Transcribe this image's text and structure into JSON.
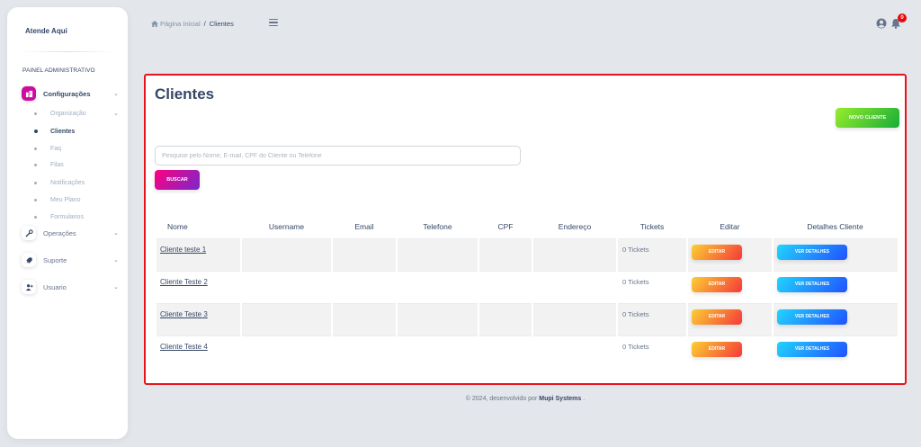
{
  "sidebar": {
    "brand": "Atende Aqui",
    "section_label": "PAINEL ADMINISTRATIVO",
    "nav": [
      {
        "label": "Configurações",
        "icon": "building-icon",
        "active": true
      },
      {
        "label": "Operações",
        "icon": "tools-icon",
        "active": false
      },
      {
        "label": "Suporte",
        "icon": "rocket-icon",
        "active": false
      },
      {
        "label": "Usuario",
        "icon": "user-plus-icon",
        "active": false
      }
    ],
    "sub_items": [
      {
        "label": "Organização",
        "active": false,
        "has_chevron": true
      },
      {
        "label": "Clientes",
        "active": true,
        "has_chevron": false
      },
      {
        "label": "Faq",
        "active": false,
        "has_chevron": false
      },
      {
        "label": "Filas",
        "active": false,
        "has_chevron": false
      },
      {
        "label": "Notificações",
        "active": false,
        "has_chevron": false
      },
      {
        "label": "Meu Plano",
        "active": false,
        "has_chevron": false
      },
      {
        "label": "Formularios",
        "active": false,
        "has_chevron": false
      }
    ]
  },
  "topbar": {
    "breadcrumb_home": "Página Inicial",
    "breadcrumb_sep": "/",
    "breadcrumb_current": "Clientes",
    "notification_count": "0"
  },
  "main": {
    "title": "Clientes",
    "new_button": "NOVO CLIENTE",
    "search_placeholder": "Pesquise pelo Nome, E-mail, CPF do Cliente ou Telefone",
    "search_value": "",
    "search_button": "BUSCAR",
    "table": {
      "headers": [
        "Nome",
        "Username",
        "Email",
        "Telefone",
        "CPF",
        "Endereço",
        "Tickets",
        "Editar",
        "Detalhes Cliente"
      ],
      "rows": [
        {
          "name": "Cliente teste 1",
          "tickets": "0 Tickets",
          "edit": "EDITAR",
          "details": "VER DETALHES"
        },
        {
          "name": "Cliente Teste 2",
          "tickets": "0 Tickets",
          "edit": "EDITAR",
          "details": "VER DETALHES"
        },
        {
          "name": "Cliente Teste 3",
          "tickets": "0 Tickets",
          "edit": "EDITAR",
          "details": "VER DETALHES"
        },
        {
          "name": "Cliente Teste 4",
          "tickets": "0 Tickets",
          "edit": "EDITAR",
          "details": "VER DETALHES"
        }
      ]
    }
  },
  "footer": {
    "text": "© 2024, desenvolvido por",
    "company": "Mupi Systems",
    "suffix": "."
  },
  "colors": {
    "accent": "#cb0c9f",
    "highlight_border": "#e8141c",
    "green": "#17ad37",
    "orange": "#f53939",
    "blue": "#2152ff"
  }
}
